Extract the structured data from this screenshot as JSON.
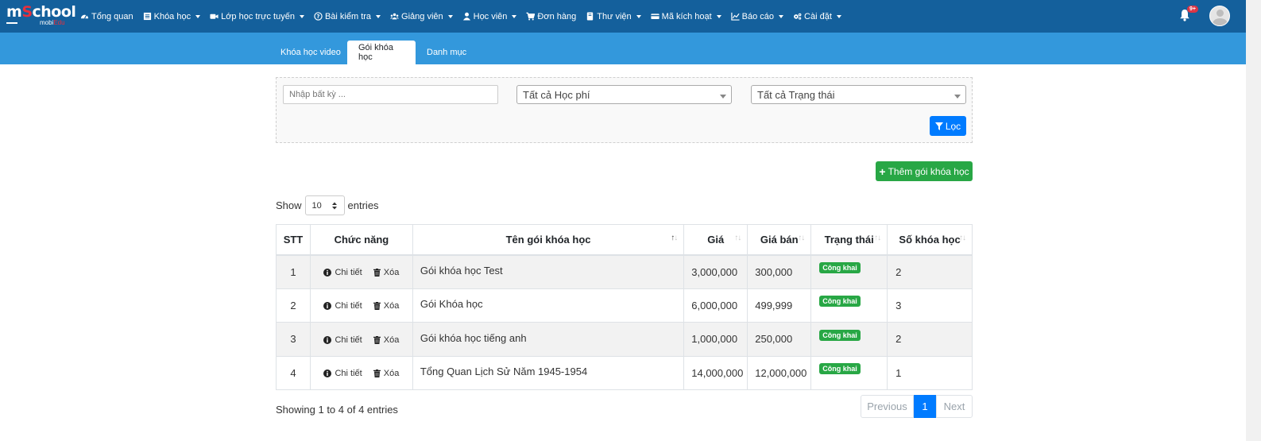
{
  "brand": {
    "name_prefix": "m",
    "name_accent": "S",
    "name_suffix": "chool",
    "sub_prefix": "mobi",
    "sub_accent": "Edu",
    "accent_color": "#e8303c"
  },
  "nav": {
    "items": [
      {
        "label": "Tổng quan",
        "icon": "dashboard-icon",
        "dropdown": false
      },
      {
        "label": "Khóa học",
        "icon": "list-icon",
        "dropdown": true
      },
      {
        "label": "Lớp học trực tuyến",
        "icon": "video-camera-icon",
        "dropdown": true
      },
      {
        "label": "Bài kiểm tra",
        "icon": "question-circle-icon",
        "dropdown": true
      },
      {
        "label": "Giảng viên",
        "icon": "users-icon",
        "dropdown": true
      },
      {
        "label": "Học viên",
        "icon": "user-icon",
        "dropdown": true
      },
      {
        "label": "Đơn hàng",
        "icon": "cart-icon",
        "dropdown": false
      },
      {
        "label": "Thư viện",
        "icon": "book-icon",
        "dropdown": true
      },
      {
        "label": "Mã kích hoạt",
        "icon": "credit-card-icon",
        "dropdown": true
      },
      {
        "label": "Báo cáo",
        "icon": "line-chart-icon",
        "dropdown": true
      },
      {
        "label": "Cài đặt",
        "icon": "cogs-icon",
        "dropdown": true
      }
    ],
    "notification_badge": "9+",
    "bar_color": "#14609c"
  },
  "tabs": [
    {
      "label": "Khóa học video",
      "active": false
    },
    {
      "label": "Gói khóa học",
      "active": true
    },
    {
      "label": "Danh mục",
      "active": false
    }
  ],
  "filter": {
    "search_placeholder": "Nhập bất kỳ ...",
    "fee_select": "Tất cả Học phí",
    "status_select": "Tất cả Trạng thái",
    "filter_button": "Lọc"
  },
  "add_button": "Thêm gói khóa học",
  "length": {
    "show": "Show",
    "value": "10",
    "entries": "entries"
  },
  "table": {
    "columns": [
      "STT",
      "Chức năng",
      "Tên gói khóa học",
      "Giá",
      "Giá bán",
      "Trạng thái",
      "Số khóa học"
    ],
    "action_detail": "Chi tiết",
    "action_delete": "Xóa",
    "rows": [
      {
        "stt": "1",
        "name": "Gói khóa học Test",
        "price": "3,000,000",
        "sale_price": "300,000",
        "status": "Công khai",
        "count": "2"
      },
      {
        "stt": "2",
        "name": "Gói Khóa học",
        "price": "6,000,000",
        "sale_price": "499,999",
        "status": "Công khai",
        "count": "3"
      },
      {
        "stt": "3",
        "name": "Gói khóa học tiếng anh",
        "price": "1,000,000",
        "sale_price": "250,000",
        "status": "Công khai",
        "count": "2"
      },
      {
        "stt": "4",
        "name": "Tổng Quan Lịch Sử Năm 1945-1954",
        "price": "14,000,000",
        "sale_price": "12,000,000",
        "status": "Công khai",
        "count": "1"
      }
    ]
  },
  "info": "Showing 1 to 4 of 4 entries",
  "pagination": {
    "previous": "Previous",
    "current": "1",
    "next": "Next"
  }
}
